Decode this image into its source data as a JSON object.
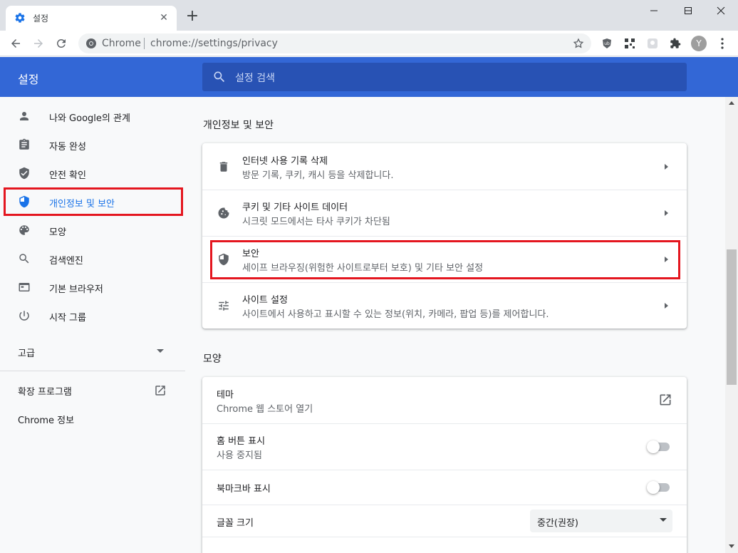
{
  "tab": {
    "title": "설정",
    "close": "✕",
    "new_tab": "+"
  },
  "window": {
    "minimize": "—",
    "maximize": "☐",
    "close": "✕"
  },
  "toolbar": {
    "site_label": "Chrome",
    "url": "chrome://settings/privacy",
    "avatar_letter": "Y"
  },
  "header": {
    "title": "설정",
    "search_placeholder": "설정 검색"
  },
  "sidebar": {
    "items": [
      {
        "label": "나와 Google의 관계",
        "icon": "person-icon"
      },
      {
        "label": "자동 완성",
        "icon": "clipboard-icon"
      },
      {
        "label": "안전 확인",
        "icon": "shield-check-icon"
      },
      {
        "label": "개인정보 및 보안",
        "icon": "shield-icon"
      },
      {
        "label": "모양",
        "icon": "palette-icon"
      },
      {
        "label": "검색엔진",
        "icon": "search-icon"
      },
      {
        "label": "기본 브라우저",
        "icon": "browser-icon"
      },
      {
        "label": "시작 그룹",
        "icon": "power-icon"
      }
    ],
    "advanced": "고급",
    "extensions": "확장 프로그램",
    "about": "Chrome 정보"
  },
  "privacy_section": {
    "title": "개인정보 및 보안",
    "rows": [
      {
        "title": "인터넷 사용 기록 삭제",
        "subtitle": "방문 기록, 쿠키, 캐시 등을 삭제합니다.",
        "icon": "trash-icon"
      },
      {
        "title": "쿠키 및 기타 사이트 데이터",
        "subtitle": "시크릿 모드에서는 타사 쿠키가 차단됨",
        "icon": "cookie-icon"
      },
      {
        "title": "보안",
        "subtitle": "세이프 브라우징(위험한 사이트로부터 보호) 및 기타 보안 설정",
        "icon": "shield-icon"
      },
      {
        "title": "사이트 설정",
        "subtitle": "사이트에서 사용하고 표시할 수 있는 정보(위치, 카메라, 팝업 등)를 제어합니다.",
        "icon": "tune-icon"
      }
    ]
  },
  "appearance_section": {
    "title": "모양",
    "theme_title": "테마",
    "theme_sub": "Chrome 웹 스토어 열기",
    "home_title": "홈 버튼 표시",
    "home_sub": "사용 중지됨",
    "home_enabled": false,
    "bookmarks_title": "북마크바 표시",
    "bookmarks_enabled": false,
    "font_title": "글꼴 크기",
    "font_value": "중간(권장)"
  },
  "colors": {
    "header_blue": "#3367d6",
    "accent": "#1a73e8",
    "highlight_red": "#e4161f"
  }
}
